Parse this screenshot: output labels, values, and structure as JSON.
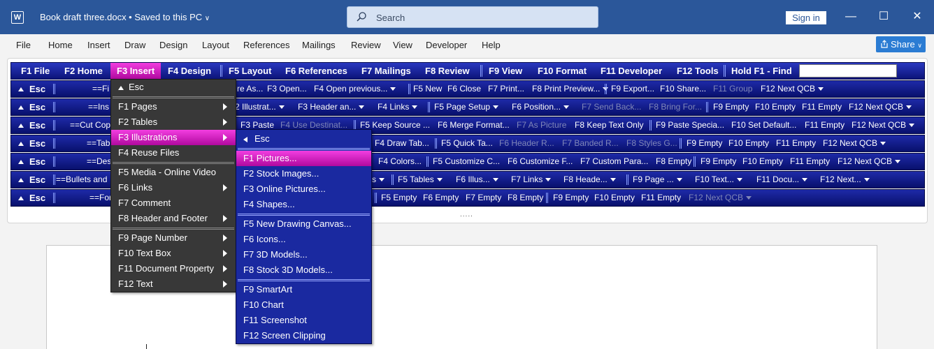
{
  "titlebar": {
    "app_icon": "word-icon",
    "app_icon_letter": "W",
    "doc_title": "Book draft three.docx • Saved to this PC",
    "search_placeholder": "Search",
    "signin_label": "Sign in",
    "minimize_glyph": "—",
    "maximize_glyph": "☐",
    "close_glyph": "✕",
    "bg_color": "#2b579a"
  },
  "menubar": {
    "items": [
      "File",
      "Home",
      "Insert",
      "Draw",
      "Design",
      "Layout",
      "References",
      "Mailings",
      "Review",
      "View",
      "Developer",
      "Help"
    ],
    "share_label": "Share"
  },
  "qcb": {
    "tabs": [
      "F1 File",
      "F2 Home",
      "F3 Insert",
      "F4 Design",
      "F5 Layout",
      "F6 References",
      "F7 Mailings",
      "F8 Review",
      "F9 View",
      "F10 Format",
      "F11 Developer",
      "F12 Tools"
    ],
    "selected_tab": "F3 Insert",
    "find_label": "Hold F1 - Find",
    "highlight_color": "#d020c0",
    "bar_color": "#1e2aa8",
    "rows": [
      {
        "esc": "Esc",
        "title": "==Fi",
        "cells": [
          {
            "text": "re As..."
          },
          {
            "text": "F3 Open..."
          },
          {
            "text": "F4 Open previous...",
            "dd": true
          },
          {
            "text": "F5 New"
          },
          {
            "text": "F6 Close"
          },
          {
            "text": "F7 Print..."
          },
          {
            "text": "F8 Print Preview...",
            "dd": true
          },
          {
            "text": "F9 Export..."
          },
          {
            "text": "F10 Share..."
          },
          {
            "text": "F11 Group",
            "dis": true
          },
          {
            "text": "F12 Next QCB",
            "dd": true
          }
        ]
      },
      {
        "esc": "Esc",
        "title": "==Ins",
        "cells": [
          {
            "text": "2 Illustrat...",
            "dd": true
          },
          {
            "text": "F3 Header an...",
            "dd": true
          },
          {
            "text": "F4 Links",
            "dd": true
          },
          {
            "text": "F5 Page Setup",
            "dd": true
          },
          {
            "text": "F6 Position...",
            "dd": true
          },
          {
            "text": "F7 Send Back...",
            "dis": true
          },
          {
            "text": "F8 Bring For...",
            "dis": true
          },
          {
            "text": "F9 Empty"
          },
          {
            "text": "F10 Empty"
          },
          {
            "text": "F11 Empty"
          },
          {
            "text": "F12 Next QCB",
            "dd": true
          }
        ]
      },
      {
        "esc": "Esc",
        "title": "==Cut Cop",
        "cells": [
          {
            "text": "F3 Paste"
          },
          {
            "text": "F4 Use Destinat...",
            "dis": true
          },
          {
            "text": "F5 Keep Source ..."
          },
          {
            "text": "F6 Merge Format..."
          },
          {
            "text": "F7 As Picture",
            "dis": true
          },
          {
            "text": "F8 Keep Text Only"
          },
          {
            "text": "F9 Paste Specia..."
          },
          {
            "text": "F10 Set Default..."
          },
          {
            "text": "F11 Empty"
          },
          {
            "text": "F12 Next QCB",
            "dd": true
          }
        ]
      },
      {
        "esc": "Esc",
        "title": "==Tab",
        "cells": [
          {
            "text": "F4 Draw Tab..."
          },
          {
            "text": "F5 Quick Ta..."
          },
          {
            "text": "F6 Header R...",
            "dis": true
          },
          {
            "text": "F7 Banded R...",
            "dis": true
          },
          {
            "text": "F8 Styles G...",
            "dis": true
          },
          {
            "text": "F9 Empty"
          },
          {
            "text": "F10 Empty"
          },
          {
            "text": "F11 Empty"
          },
          {
            "text": "F12 Next QCB",
            "dd": true
          }
        ]
      },
      {
        "esc": "Esc",
        "title": "==Des",
        "cells": [
          {
            "text": "F4 Colors..."
          },
          {
            "text": "F5 Customize C..."
          },
          {
            "text": "F6 Customize F..."
          },
          {
            "text": "F7 Custom Para..."
          },
          {
            "text": "F8 Empty"
          },
          {
            "text": "F9 Empty"
          },
          {
            "text": "F10 Empty"
          },
          {
            "text": "F11 Empty"
          },
          {
            "text": "F12 Next QCB",
            "dd": true
          }
        ]
      },
      {
        "esc": "Esc",
        "title": "==Bullets and",
        "cells": [
          {
            "text": "s",
            "dd": true
          },
          {
            "text": "F5 Tables",
            "dd": true
          },
          {
            "text": "F6 Illus...",
            "dd": true
          },
          {
            "text": "F7 Links",
            "dd": true
          },
          {
            "text": "F8 Heade...",
            "dd": true
          },
          {
            "text": "F9 Page ...",
            "dd": true
          },
          {
            "text": "F10 Text...",
            "dd": true
          },
          {
            "text": "F11 Docu...",
            "dd": true
          },
          {
            "text": "F12 Next...",
            "dd": true
          }
        ]
      },
      {
        "esc": "Esc",
        "title": "==For",
        "cells": [
          {
            "text": "F5 Empty"
          },
          {
            "text": "F6 Empty"
          },
          {
            "text": "F7 Empty"
          },
          {
            "text": "F8 Empty"
          },
          {
            "text": "F9 Empty"
          },
          {
            "text": "F10 Empty"
          },
          {
            "text": "F11 Empty"
          },
          {
            "text": "F12 Next QCB",
            "dis": true,
            "dd": true
          }
        ]
      }
    ]
  },
  "menu1": {
    "esc": "Esc",
    "groups": [
      [
        {
          "label": "F1 Pages",
          "sub": true
        },
        {
          "label": "F2 Tables",
          "sub": true
        },
        {
          "label": "F3 Illustrations",
          "sub": true,
          "hi": true
        },
        {
          "label": "F4 Reuse Files"
        }
      ],
      [
        {
          "label": "F5 Media - Online Video"
        },
        {
          "label": "F6 Links",
          "sub": true
        },
        {
          "label": "F7 Comment"
        },
        {
          "label": "F8 Header and Footer",
          "sub": true
        }
      ],
      [
        {
          "label": "F9 Page Number",
          "sub": true
        },
        {
          "label": "F10 Text Box",
          "sub": true
        },
        {
          "label": "F11 Document Property",
          "sub": true
        },
        {
          "label": "F12 Text",
          "sub": true
        }
      ]
    ]
  },
  "menu2": {
    "esc": "Esc",
    "groups": [
      [
        {
          "label": "F1 Pictures...",
          "hi": true
        },
        {
          "label": "F2 Stock Images..."
        },
        {
          "label": "F3 Online Pictures..."
        },
        {
          "label": "F4 Shapes..."
        }
      ],
      [
        {
          "label": "F5 New Drawing Canvas..."
        },
        {
          "label": "F6 Icons..."
        },
        {
          "label": "F7 3D Models..."
        },
        {
          "label": "F8 Stock 3D Models..."
        }
      ],
      [
        {
          "label": "F9 SmartArt"
        },
        {
          "label": "F10 Chart"
        },
        {
          "label": "F11 Screenshot"
        },
        {
          "label": "F12 Screen Clipping"
        }
      ]
    ]
  },
  "ribbon_collapse_glyph": "....."
}
